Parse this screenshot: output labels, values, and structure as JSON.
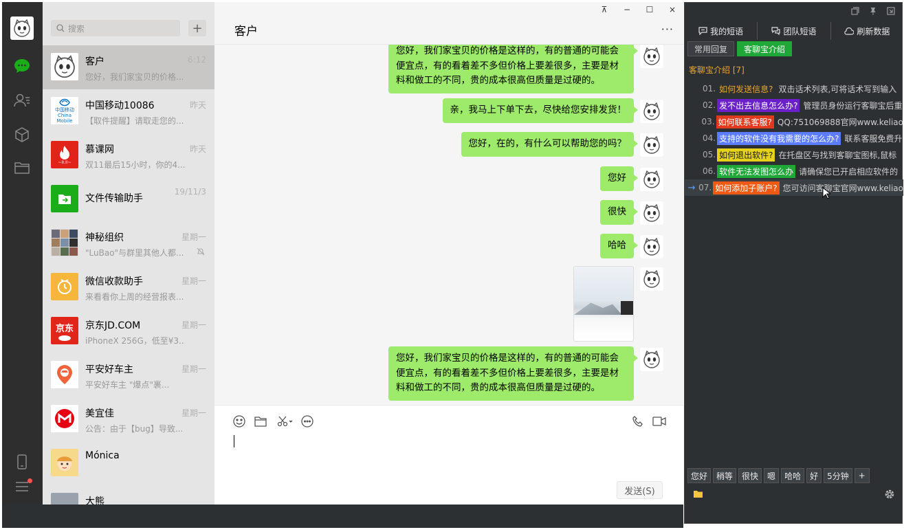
{
  "sidebar": {
    "icons": [
      "avatar-cat-icon",
      "chat-icon",
      "contacts-icon",
      "cube-icon",
      "folder-icon",
      "phone-icon",
      "menu-icon"
    ]
  },
  "search": {
    "placeholder": "搜索",
    "add": "+"
  },
  "chats": [
    {
      "name": "客户",
      "time": "6:12",
      "preview": "您好，我们家宝贝的价格..."
    },
    {
      "name": "中国移动10086",
      "time": "昨天",
      "preview": "【取件提醒】请取走您的..."
    },
    {
      "name": "慕课网",
      "time": "昨天",
      "preview": "双11最后15小时，你的4..."
    },
    {
      "name": "文件传输助手",
      "time": "19/11/3",
      "preview": ""
    },
    {
      "name": "神秘组织",
      "time": "星期一",
      "preview": "\"LuBao\"与群里其他人都..."
    },
    {
      "name": "微信收款助手",
      "time": "星期一",
      "preview": "来看看你上周的经营报表..."
    },
    {
      "name": "京东JD.COM",
      "time": "星期一",
      "preview": "iPhoneX 256G，低至¥3..."
    },
    {
      "name": "平安好车主",
      "time": "星期一",
      "preview": "平安好车主 \"爆点\"裹..."
    },
    {
      "name": "美宜佳",
      "time": "星期一",
      "preview": "公告：由于【bug】导致..."
    },
    {
      "name": "Mónica",
      "time": "",
      "preview": ""
    },
    {
      "name": "大熊",
      "time": "",
      "preview": ""
    }
  ],
  "avatar_text": {
    "cmcc": "中国移动 China Mobile",
    "imooc": "~II.II~",
    "jd": "京东"
  },
  "chat": {
    "title": "客户",
    "more": "···",
    "window_buttons": [
      "⊼",
      "−",
      "☐",
      "×"
    ],
    "messages": [
      "您好，我们家宝贝的价格是这样的，有的普通的可能会便宜点，有的看着差不多但价格上要差很多，主要是材料和做工的不同，贵的成本很高但质量是过硬的。",
      "亲，我马上下单下去，尽快给您安排发货！",
      "您好，在的，有什么可以帮助您的吗？",
      "您好",
      "很快",
      "哈哈",
      "您好，我们家宝贝的价格是这样的，有的普通的可能会便宜点，有的看着差不多但价格上要差很多，主要是材料和做工的不同，贵的成本很高但质量是过硬的。"
    ],
    "send": "发送(S)"
  },
  "plugin": {
    "tabs": [
      "我的短语",
      "团队短语",
      "刷新数据"
    ],
    "sub_tabs": [
      "常用回复",
      "客聊宝介绍"
    ],
    "group_title": "客聊宝介绍 [7]",
    "items": [
      {
        "num": "01.",
        "tag": "如何发送信息?",
        "text": "双击话术列表,可将话术写到输入",
        "color": "#2d3033",
        "tagcolor": "#e8a630"
      },
      {
        "num": "02.",
        "tag": "发不出去信息怎么办?",
        "text": "管理员身份运行客聊宝后重",
        "color": "#6a1fc9",
        "tagcolor": "#ffffff"
      },
      {
        "num": "03.",
        "tag": "如何联系客服?",
        "text": "QQ:751069888官网www.keliao",
        "color": "#e03a1e",
        "tagcolor": "#ffffff"
      },
      {
        "num": "04.",
        "tag": "支持的软件没有我需要的怎么办?",
        "text": "联系客服免费升",
        "color": "#5b7cff",
        "tagcolor": "#ffffff"
      },
      {
        "num": "05.",
        "tag": "如何退出软件?",
        "text": "在托盘区与找到客聊宝图标,鼠标",
        "color": "#e6d21a",
        "tagcolor": "#1a1a1a"
      },
      {
        "num": "06.",
        "tag": "软件无法发图怎么办",
        "text": "请确保您已开启相应软件的",
        "color": "#1fa838",
        "tagcolor": "#ffffff"
      },
      {
        "num": "07.",
        "tag": "如何添加子账户?",
        "text": "您可访问客聊宝官网www.keliao",
        "color": "#ee5a14",
        "tagcolor": "#ffffff"
      }
    ],
    "quick": [
      "您好",
      "稍等",
      "很快",
      "嗯",
      "哈哈",
      "好",
      "5分钟",
      "+"
    ]
  }
}
